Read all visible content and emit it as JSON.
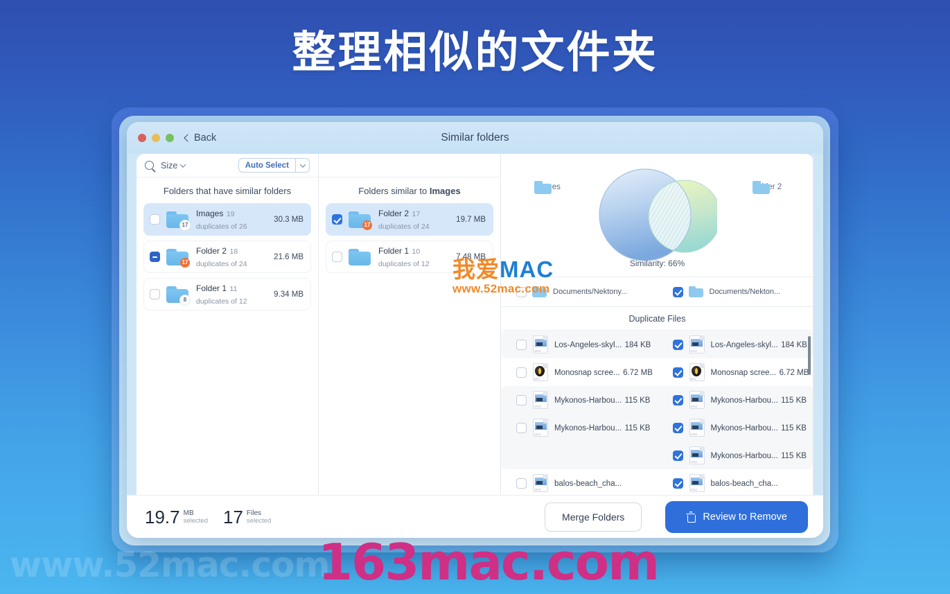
{
  "hero": {
    "title": "整理相似的文件夹"
  },
  "window": {
    "title": "Similar folders",
    "back_label": "Back",
    "traffic_lights": [
      "close",
      "minimize",
      "zoom"
    ]
  },
  "toolbar": {
    "search_icon": "search-icon",
    "sort_label": "Size",
    "auto_select_label": "Auto Select",
    "dropdown_icon": "chevron-down-icon"
  },
  "left_panel": {
    "heading": "Folders that have similar folders",
    "rows": [
      {
        "name": "Images",
        "sub": "19 duplicates of 26",
        "size": "30.3 MB",
        "badge": "17",
        "badge_style": "white",
        "check": "unchecked",
        "selected": true
      },
      {
        "name": "Folder 2",
        "sub": "18 duplicates of 24",
        "size": "21.6 MB",
        "badge": "17",
        "badge_style": "orange",
        "check": "dash",
        "selected": false
      },
      {
        "name": "Folder 1",
        "sub": "11 duplicates of 12",
        "size": "9.34 MB",
        "badge": "8",
        "badge_style": "white",
        "check": "unchecked",
        "selected": false
      }
    ]
  },
  "mid_panel": {
    "heading_prefix": "Folders similar to ",
    "heading_target": "Images",
    "rows": [
      {
        "name": "Folder 2",
        "sub": "17 duplicates of 24",
        "size": "19.7 MB",
        "badge": "17",
        "badge_style": "orange",
        "check": "checked",
        "selected": true
      },
      {
        "name": "Folder 1",
        "sub": "10 duplicates of 12",
        "size": "7.48 MB",
        "badge": "",
        "badge_style": "none",
        "check": "unchecked",
        "selected": false
      }
    ]
  },
  "right_panel": {
    "venn_left_label": "Images",
    "venn_right_label": "Folder 2",
    "similarity_label": "Similarity: 66%",
    "paths": [
      {
        "text": "Documents/Nektony...",
        "check": "unchecked"
      },
      {
        "text": "Documents/Nekton...",
        "check": "checked"
      }
    ],
    "duplicates_heading": "Duplicate Files",
    "groups": [
      {
        "alt": true,
        "left": [
          {
            "name": "Los-Angeles-skyl...",
            "size": "184 KB",
            "type": "jpg",
            "check": "unchecked"
          }
        ],
        "right": [
          {
            "name": "Los-Angeles-skyl...",
            "size": "184 KB",
            "type": "jpg",
            "check": "checked"
          }
        ]
      },
      {
        "alt": false,
        "left": [
          {
            "name": "Monosnap scree...",
            "size": "6.72 MB",
            "type": "mp4",
            "check": "unchecked"
          }
        ],
        "right": [
          {
            "name": "Monosnap scree...",
            "size": "6.72 MB",
            "type": "mp4",
            "check": "checked"
          }
        ]
      },
      {
        "alt": true,
        "left": [
          {
            "name": "Mykonos-Harbou...",
            "size": "115 KB",
            "type": "jpg",
            "check": "unchecked"
          },
          {
            "name": "Mykonos-Harbou...",
            "size": "115 KB",
            "type": "jpg",
            "check": "unchecked"
          }
        ],
        "right": [
          {
            "name": "Mykonos-Harbou...",
            "size": "115 KB",
            "type": "jpg",
            "check": "checked"
          },
          {
            "name": "Mykonos-Harbou...",
            "size": "115 KB",
            "type": "jpg",
            "check": "checked"
          },
          {
            "name": "Mykonos-Harbou...",
            "size": "115 KB",
            "type": "jpg",
            "check": "checked"
          }
        ]
      },
      {
        "alt": false,
        "left": [
          {
            "name": "balos-beach_cha...",
            "size": "",
            "type": "jpg",
            "check": "unchecked"
          }
        ],
        "right": [
          {
            "name": "balos-beach_cha...",
            "size": "",
            "type": "jpg",
            "check": "checked"
          }
        ]
      }
    ]
  },
  "footer": {
    "size_value": "19.7",
    "size_unit": "MB",
    "size_caption": "selected",
    "files_value": "17",
    "files_unit": "Files",
    "files_caption": "selected",
    "merge_label": "Merge Folders",
    "review_label": "Review to Remove",
    "review_icon": "trash-icon"
  },
  "watermarks": {
    "center_cn": "我爱",
    "center_en": "MAC",
    "center_url": "www.52mac.com",
    "bottom_left": "www.52mac.com",
    "bottom_right": "163mac.com"
  },
  "colors": {
    "accent_blue": "#2f6fdb",
    "badge_orange": "#ef7237",
    "venn_left": "#8fb8e4",
    "venn_right": "#a9dbc3"
  }
}
